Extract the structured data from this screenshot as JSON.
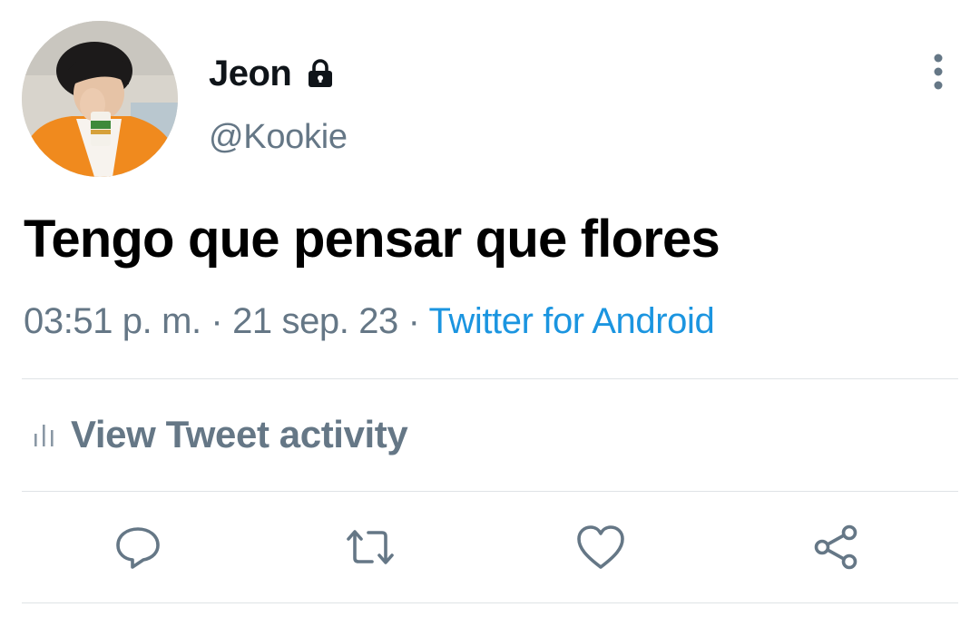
{
  "author": {
    "display_name": "Jeon",
    "handle": "@Kookie",
    "protected": true
  },
  "tweet": {
    "text": "Tengo que pensar que flores",
    "time": "03:51 p. m.",
    "separator": " · ",
    "date": "21 sep. 23",
    "source": "Twitter for Android"
  },
  "activity": {
    "label": "View Tweet activity"
  },
  "actions": [
    {
      "icon": "reply-icon"
    },
    {
      "icon": "retweet-icon"
    },
    {
      "icon": "like-icon"
    },
    {
      "icon": "share-icon"
    }
  ],
  "colors": {
    "primary_text": "#0f1419",
    "secondary_text": "#657786",
    "link": "#1b95e0",
    "divider": "#dfe3e6"
  }
}
